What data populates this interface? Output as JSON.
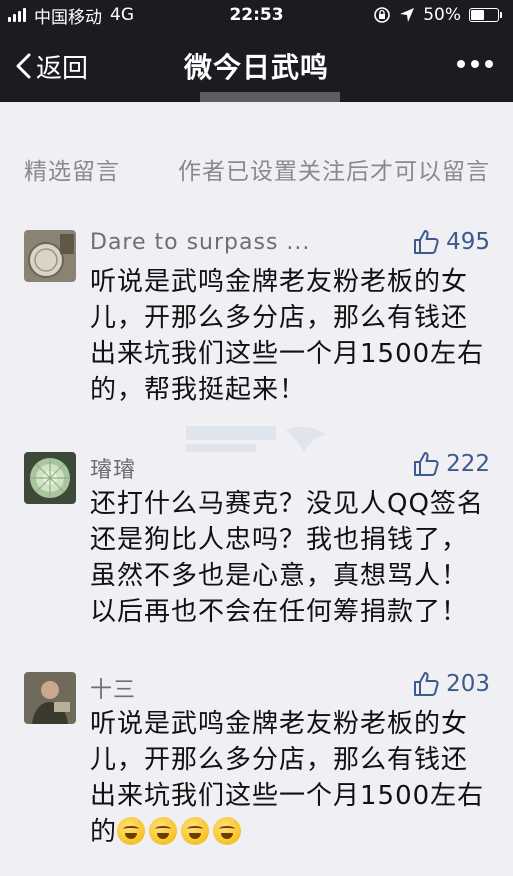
{
  "status_bar": {
    "carrier": "中国移动",
    "network": "4G",
    "time": "22:53",
    "battery": "50%",
    "battery_level": 0.5
  },
  "nav": {
    "back_label": "返回",
    "title": "微今日武鸣"
  },
  "section": {
    "left": "精选留言",
    "right": "作者已设置关注后才可以留言"
  },
  "comments": [
    {
      "name": "Dare to surpass ...",
      "likes": "495",
      "text": "听说是武鸣金牌老友粉老板的女儿，开那么多分店，那么有钱还出来坑我们这些一个月1500左右的，帮我挺起来！"
    },
    {
      "name": "璿璿",
      "likes": "222",
      "text": "还打什么马赛克？没见人QQ签名还是狗比人忠吗？我也捐钱了，虽然不多也是心意，真想骂人！以后再也不会在任何筹捐款了！"
    },
    {
      "name": "十三",
      "likes": "203",
      "text": "听说是武鸣金牌老友粉老板的女儿，开那么多分店，那么有钱还出来坑我们这些一个月1500左右的"
    }
  ],
  "colors": {
    "nav_bg": "#1b1c20",
    "page_bg": "#efeff4",
    "like_blue": "#3c5b8c"
  }
}
